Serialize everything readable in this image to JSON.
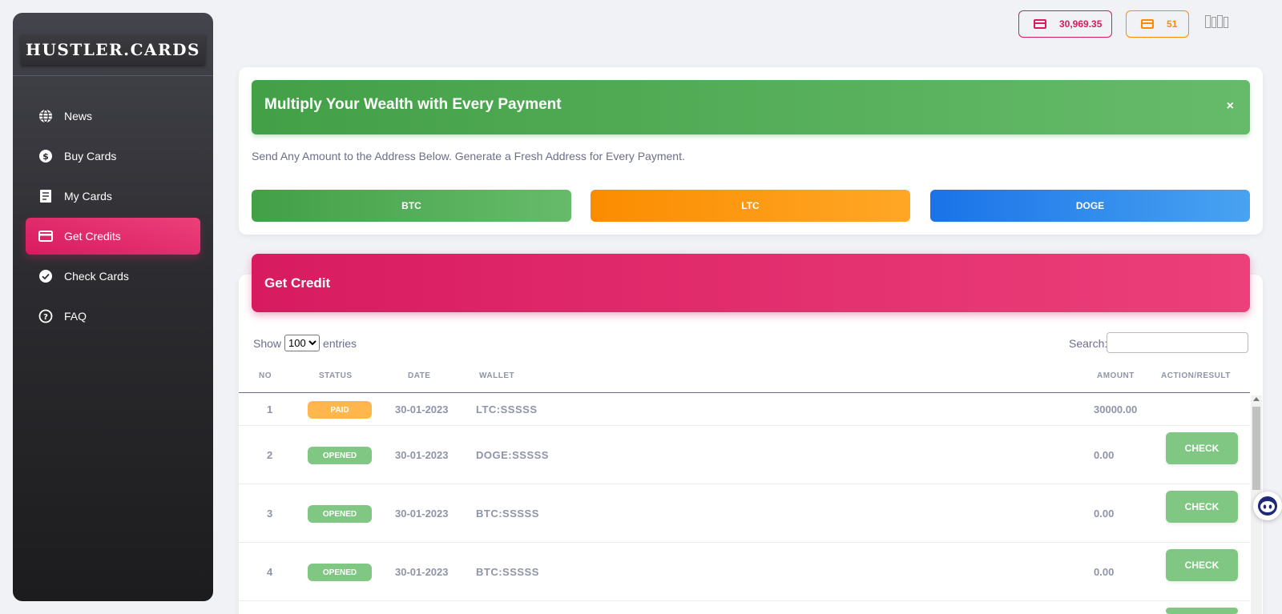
{
  "brand": "HUSTLER.CARDS",
  "sidebar": {
    "items": [
      {
        "label": "News",
        "icon": "globe-icon"
      },
      {
        "label": "Buy Cards",
        "icon": "dollar-icon"
      },
      {
        "label": "My Cards",
        "icon": "receipt-icon"
      },
      {
        "label": "Get Credits",
        "icon": "credit-card-icon",
        "active": true
      },
      {
        "label": "Check Cards",
        "icon": "check-circle-icon"
      },
      {
        "label": "FAQ",
        "icon": "help-icon"
      }
    ]
  },
  "topbar": {
    "credit_balance": "30,969.35",
    "cards_count": "51",
    "credit_color": "#d81b60",
    "cards_color": "#fb8c00"
  },
  "promo": {
    "title": "Multiply Your Wealth with Every Payment",
    "close": "×",
    "subtitle": "Send Any Amount to the Address Below. Generate a Fresh Address for Every Payment.",
    "buttons": [
      "BTC",
      "LTC",
      "DOGE"
    ]
  },
  "credit": {
    "title": "Get Credit",
    "show_label": "Show",
    "entries_label": "entries",
    "page_size": "100",
    "search_label": "Search:",
    "columns": [
      "NO",
      "STATUS",
      "DATE",
      "WALLET",
      "AMOUNT",
      "ACTION/RESULT"
    ],
    "rows": [
      {
        "no": "1",
        "status": "PAID",
        "date": "30-01-2023",
        "wallet": "LTC:SSSSS",
        "amount": "30000.00",
        "action": ""
      },
      {
        "no": "2",
        "status": "OPENED",
        "date": "30-01-2023",
        "wallet": "DOGE:SSSSS",
        "amount": "0.00",
        "action": "CHECK"
      },
      {
        "no": "3",
        "status": "OPENED",
        "date": "30-01-2023",
        "wallet": "BTC:SSSSS",
        "amount": "0.00",
        "action": "CHECK"
      },
      {
        "no": "4",
        "status": "OPENED",
        "date": "30-01-2023",
        "wallet": "BTC:SSSSS",
        "amount": "0.00",
        "action": "CHECK"
      }
    ]
  }
}
